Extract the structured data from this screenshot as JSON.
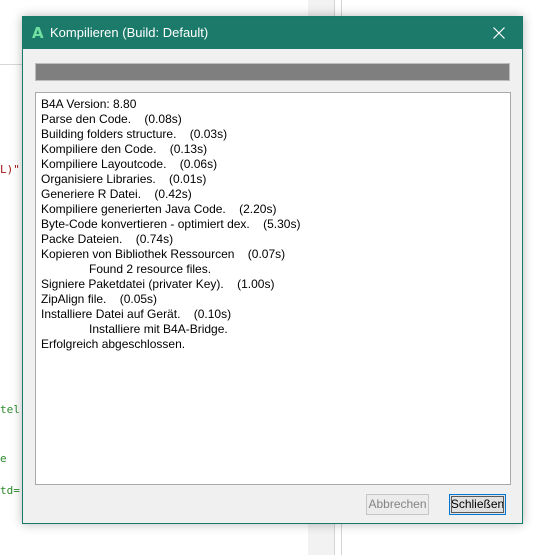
{
  "background": {
    "code_fragments": [
      {
        "text": "L)\"",
        "color": "#a31515"
      },
      {
        "text": "tel",
        "color": "#2e8b2e"
      },
      {
        "text": "e",
        "color": "#2e8b2e"
      },
      {
        "text": "td=",
        "color": "#2e8b2e"
      }
    ]
  },
  "dialog": {
    "app_icon_glyph": "A",
    "title": "Kompilieren (Build: Default)",
    "close_glyph": "close-icon",
    "progress_percent": 100,
    "log_lines": [
      {
        "text": "B4A Version: 8.80",
        "indent": false
      },
      {
        "text": "Parse den Code.    (0.08s)",
        "indent": false
      },
      {
        "text": "Building folders structure.    (0.03s)",
        "indent": false
      },
      {
        "text": "Kompiliere den Code.    (0.13s)",
        "indent": false
      },
      {
        "text": "Kompiliere Layoutcode.    (0.06s)",
        "indent": false
      },
      {
        "text": "Organisiere Libraries.    (0.01s)",
        "indent": false
      },
      {
        "text": "Generiere R Datei.    (0.42s)",
        "indent": false
      },
      {
        "text": "Kompiliere generierten Java Code.    (2.20s)",
        "indent": false
      },
      {
        "text": "Byte-Code konvertieren - optimiert dex.    (5.30s)",
        "indent": false
      },
      {
        "text": "Packe Dateien.    (0.74s)",
        "indent": false
      },
      {
        "text": "Kopieren von Bibliothek Ressourcen    (0.07s)",
        "indent": false
      },
      {
        "text": "Found 2 resource files.",
        "indent": true
      },
      {
        "text": "Signiere Paketdatei (privater Key).    (1.00s)",
        "indent": false
      },
      {
        "text": "ZipAlign file.    (0.05s)",
        "indent": false
      },
      {
        "text": "Installiere Datei auf Gerät.    (0.10s)",
        "indent": false
      },
      {
        "text": "Installiere mit B4A-Bridge.",
        "indent": true
      },
      {
        "text": "Erfolgreich abgeschlossen.",
        "indent": false
      }
    ],
    "buttons": {
      "cancel_label": "Abbrechen",
      "close_label": "Schließen"
    },
    "colors": {
      "titlebar": "#1b7a69",
      "accent_icon": "#6fe0a0",
      "progress": "#7f7f7f"
    }
  }
}
